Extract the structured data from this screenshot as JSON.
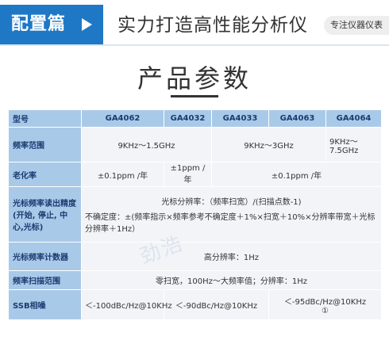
{
  "banner": {
    "tag": "配置篇",
    "slogan": "实力打造高性能分析仪",
    "badge": "专注仪器仪表"
  },
  "title": "产品参数",
  "table": {
    "header": [
      "型号",
      "GA4062",
      "GA4032",
      "GA4033",
      "GA4063",
      "GA4064"
    ],
    "freq_range": {
      "label": "频率范围",
      "v1": "9KHz～1.5GHz",
      "v2": "9KHz～3GHz",
      "v3": "9KHz～7.5GHz"
    },
    "aging": {
      "label": "老化率",
      "v1": "±0.1ppm /年",
      "v2": "±1ppm /年",
      "v3": "±0.1ppm /年"
    },
    "cursor_read": {
      "label": "光标频率读出精度(开始, 停止, 中心,光标)",
      "line1": "光标分辨率：（频率扫宽）/(扫描点数-1)",
      "line2": "不确定度：±(频率指示×频率参考不确定度＋1%×扫宽＋10%×分辨率带宽＋光标分辨率＋1Hz）"
    },
    "counter": {
      "label": "光标频率计数器",
      "value": "高分辨率：1Hz"
    },
    "sweep": {
      "label": "频率扫描范围",
      "value": "零扫宽，100Hz～大频率值；分辨率：1Hz"
    },
    "ssb": {
      "label": "SSB相噪",
      "v1": "＜-100dBc/Hz@10KHz",
      "v2": "＜-90dBc/Hz@10KHz",
      "v3": "＜-95dBc/Hz@10KHz",
      "note": "①"
    }
  },
  "watermark": "劲浩"
}
